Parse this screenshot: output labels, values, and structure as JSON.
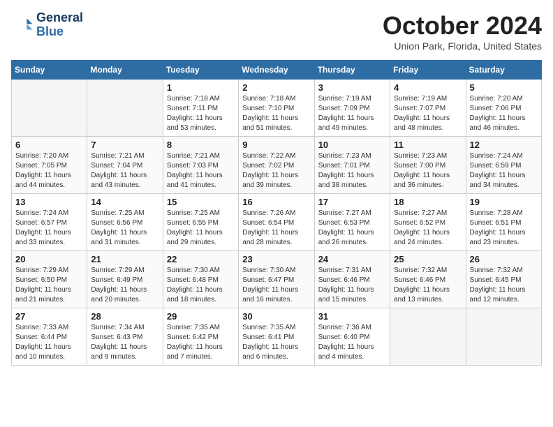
{
  "header": {
    "logo_line1": "General",
    "logo_line2": "Blue",
    "month_title": "October 2024",
    "location": "Union Park, Florida, United States"
  },
  "days_of_week": [
    "Sunday",
    "Monday",
    "Tuesday",
    "Wednesday",
    "Thursday",
    "Friday",
    "Saturday"
  ],
  "weeks": [
    [
      {
        "day": "",
        "empty": true
      },
      {
        "day": "",
        "empty": true
      },
      {
        "day": "1",
        "sunrise": "Sunrise: 7:18 AM",
        "sunset": "Sunset: 7:11 PM",
        "daylight": "Daylight: 11 hours and 53 minutes."
      },
      {
        "day": "2",
        "sunrise": "Sunrise: 7:18 AM",
        "sunset": "Sunset: 7:10 PM",
        "daylight": "Daylight: 11 hours and 51 minutes."
      },
      {
        "day": "3",
        "sunrise": "Sunrise: 7:19 AM",
        "sunset": "Sunset: 7:09 PM",
        "daylight": "Daylight: 11 hours and 49 minutes."
      },
      {
        "day": "4",
        "sunrise": "Sunrise: 7:19 AM",
        "sunset": "Sunset: 7:07 PM",
        "daylight": "Daylight: 11 hours and 48 minutes."
      },
      {
        "day": "5",
        "sunrise": "Sunrise: 7:20 AM",
        "sunset": "Sunset: 7:06 PM",
        "daylight": "Daylight: 11 hours and 46 minutes."
      }
    ],
    [
      {
        "day": "6",
        "sunrise": "Sunrise: 7:20 AM",
        "sunset": "Sunset: 7:05 PM",
        "daylight": "Daylight: 11 hours and 44 minutes."
      },
      {
        "day": "7",
        "sunrise": "Sunrise: 7:21 AM",
        "sunset": "Sunset: 7:04 PM",
        "daylight": "Daylight: 11 hours and 43 minutes."
      },
      {
        "day": "8",
        "sunrise": "Sunrise: 7:21 AM",
        "sunset": "Sunset: 7:03 PM",
        "daylight": "Daylight: 11 hours and 41 minutes."
      },
      {
        "day": "9",
        "sunrise": "Sunrise: 7:22 AM",
        "sunset": "Sunset: 7:02 PM",
        "daylight": "Daylight: 11 hours and 39 minutes."
      },
      {
        "day": "10",
        "sunrise": "Sunrise: 7:23 AM",
        "sunset": "Sunset: 7:01 PM",
        "daylight": "Daylight: 11 hours and 38 minutes."
      },
      {
        "day": "11",
        "sunrise": "Sunrise: 7:23 AM",
        "sunset": "Sunset: 7:00 PM",
        "daylight": "Daylight: 11 hours and 36 minutes."
      },
      {
        "day": "12",
        "sunrise": "Sunrise: 7:24 AM",
        "sunset": "Sunset: 6:59 PM",
        "daylight": "Daylight: 11 hours and 34 minutes."
      }
    ],
    [
      {
        "day": "13",
        "sunrise": "Sunrise: 7:24 AM",
        "sunset": "Sunset: 6:57 PM",
        "daylight": "Daylight: 11 hours and 33 minutes."
      },
      {
        "day": "14",
        "sunrise": "Sunrise: 7:25 AM",
        "sunset": "Sunset: 6:56 PM",
        "daylight": "Daylight: 11 hours and 31 minutes."
      },
      {
        "day": "15",
        "sunrise": "Sunrise: 7:25 AM",
        "sunset": "Sunset: 6:55 PM",
        "daylight": "Daylight: 11 hours and 29 minutes."
      },
      {
        "day": "16",
        "sunrise": "Sunrise: 7:26 AM",
        "sunset": "Sunset: 6:54 PM",
        "daylight": "Daylight: 11 hours and 28 minutes."
      },
      {
        "day": "17",
        "sunrise": "Sunrise: 7:27 AM",
        "sunset": "Sunset: 6:53 PM",
        "daylight": "Daylight: 11 hours and 26 minutes."
      },
      {
        "day": "18",
        "sunrise": "Sunrise: 7:27 AM",
        "sunset": "Sunset: 6:52 PM",
        "daylight": "Daylight: 11 hours and 24 minutes."
      },
      {
        "day": "19",
        "sunrise": "Sunrise: 7:28 AM",
        "sunset": "Sunset: 6:51 PM",
        "daylight": "Daylight: 11 hours and 23 minutes."
      }
    ],
    [
      {
        "day": "20",
        "sunrise": "Sunrise: 7:29 AM",
        "sunset": "Sunset: 6:50 PM",
        "daylight": "Daylight: 11 hours and 21 minutes."
      },
      {
        "day": "21",
        "sunrise": "Sunrise: 7:29 AM",
        "sunset": "Sunset: 6:49 PM",
        "daylight": "Daylight: 11 hours and 20 minutes."
      },
      {
        "day": "22",
        "sunrise": "Sunrise: 7:30 AM",
        "sunset": "Sunset: 6:48 PM",
        "daylight": "Daylight: 11 hours and 18 minutes."
      },
      {
        "day": "23",
        "sunrise": "Sunrise: 7:30 AM",
        "sunset": "Sunset: 6:47 PM",
        "daylight": "Daylight: 11 hours and 16 minutes."
      },
      {
        "day": "24",
        "sunrise": "Sunrise: 7:31 AM",
        "sunset": "Sunset: 6:46 PM",
        "daylight": "Daylight: 11 hours and 15 minutes."
      },
      {
        "day": "25",
        "sunrise": "Sunrise: 7:32 AM",
        "sunset": "Sunset: 6:46 PM",
        "daylight": "Daylight: 11 hours and 13 minutes."
      },
      {
        "day": "26",
        "sunrise": "Sunrise: 7:32 AM",
        "sunset": "Sunset: 6:45 PM",
        "daylight": "Daylight: 11 hours and 12 minutes."
      }
    ],
    [
      {
        "day": "27",
        "sunrise": "Sunrise: 7:33 AM",
        "sunset": "Sunset: 6:44 PM",
        "daylight": "Daylight: 11 hours and 10 minutes."
      },
      {
        "day": "28",
        "sunrise": "Sunrise: 7:34 AM",
        "sunset": "Sunset: 6:43 PM",
        "daylight": "Daylight: 11 hours and 9 minutes."
      },
      {
        "day": "29",
        "sunrise": "Sunrise: 7:35 AM",
        "sunset": "Sunset: 6:42 PM",
        "daylight": "Daylight: 11 hours and 7 minutes."
      },
      {
        "day": "30",
        "sunrise": "Sunrise: 7:35 AM",
        "sunset": "Sunset: 6:41 PM",
        "daylight": "Daylight: 11 hours and 6 minutes."
      },
      {
        "day": "31",
        "sunrise": "Sunrise: 7:36 AM",
        "sunset": "Sunset: 6:40 PM",
        "daylight": "Daylight: 11 hours and 4 minutes."
      },
      {
        "day": "",
        "empty": true
      },
      {
        "day": "",
        "empty": true
      }
    ]
  ]
}
